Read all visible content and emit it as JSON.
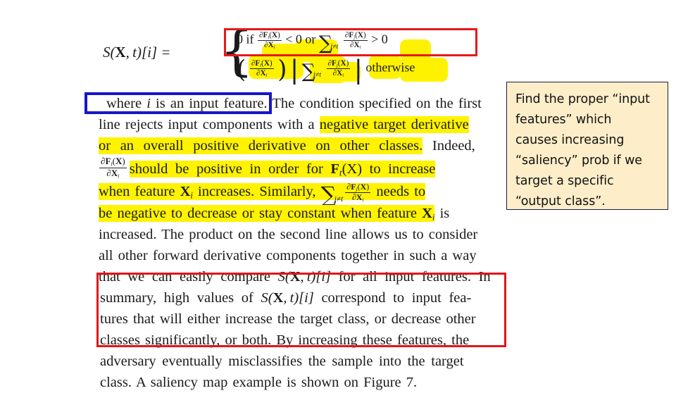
{
  "slide": {
    "background_color": "#ffffff",
    "paper_text_color": "#1b1b1b"
  },
  "equation": {
    "lhs": "S(X, t)[i] =",
    "brace": "{",
    "case_1": {
      "value": "0",
      "condition_prefix": "if",
      "term_1_num": "∂F",
      "term_1_num_sub": "t",
      "term_1_num_arg": "(X)",
      "term_1_den": "∂X",
      "term_1_den_sub": "i",
      "comparator_1": "< 0",
      "connector": "or",
      "sum_symbol": "∑",
      "sum_subscript": "j≠t",
      "term_2_num": "∂F",
      "term_2_num_sub": "j",
      "term_2_num_arg": "(X)",
      "term_2_den": "∂X",
      "term_2_den_sub": "i",
      "comparator_2": "> 0"
    },
    "case_2": {
      "open_paren": "(",
      "term_1_num": "∂F",
      "term_1_num_sub": "t",
      "term_1_num_arg": "(X)",
      "term_1_den": "∂X",
      "term_1_den_sub": "i",
      "close_paren": ")",
      "abs_bar": "|",
      "sum_symbol": "∑",
      "sum_subscript": "j≠t",
      "term_2_num": "∂F",
      "term_2_num_sub": "j",
      "term_2_num_arg": "(X)",
      "term_2_den": "∂X",
      "term_2_den_sub": "i",
      "otherwise": "otherwise"
    }
  },
  "paragraph_lines": [
    {
      "id": "l1",
      "plain_before": "where ",
      "italic": "i",
      "plain_after": " is an input feature. The condition specified on the first",
      "highlight": "none"
    },
    {
      "id": "l2",
      "text_plain": "line rejects input components with a ",
      "text_highlight": "negative target derivative",
      "highlight": "tail"
    },
    {
      "id": "l3",
      "text_highlight": "or an overall positive derivative on other classes.",
      "text_plain": " Indeed,",
      "highlight": "head"
    },
    {
      "id": "l4",
      "text_highlight": "should be positive in order for",
      "text_math": "F_t(X)",
      "text_highlight_2": "to increase",
      "highlight": "full-with-math"
    },
    {
      "id": "l5",
      "text_highlight": "when feature X_i increases. Similarly, ∑_{j≠t} ∂F_j(X)/∂X_i needs to",
      "highlight": "full"
    },
    {
      "id": "l6",
      "text_highlight": "be negative to decrease or stay constant when feature X_i",
      "text_plain": " is",
      "highlight": "most"
    },
    {
      "id": "l7",
      "text": "increased. The product on the second line allows us to consider",
      "highlight": "none"
    },
    {
      "id": "l8",
      "text": "all other forward derivative components together in such a way",
      "highlight": "none"
    },
    {
      "id": "l9",
      "text": "that we can easily compare S(X, t)[i] for all input features. In",
      "highlight": "none"
    },
    {
      "id": "l10",
      "text": "summary, high values of S(X, t)[i] correspond to input fea-",
      "highlight": "none"
    },
    {
      "id": "l11",
      "text": "tures that will either increase the target class, or decrease other",
      "highlight": "none"
    },
    {
      "id": "l12",
      "text": "classes significantly, or both. By increasing these features, the",
      "highlight": "none"
    },
    {
      "id": "l13",
      "text": "adversary eventually misclassifies the sample into the target",
      "highlight": "none"
    },
    {
      "id": "l14",
      "text": "class. A saliency map example is shown on Figure 7.",
      "highlight": "none"
    }
  ],
  "line_text": {
    "l1_a": "where ",
    "l1_i": "i",
    "l1_b": " is an input feature. The condition specified on the first",
    "l2_a": "line rejects input components with a ",
    "l2_hl": "negative target derivative",
    "l3_hl": "or an overall positive derivative on other classes.",
    "l3_b": " Indeed,",
    "l4_hl_a": "should be positive in order for",
    "l4_math": "F",
    "l4_math_sub": "t",
    "l4_math_arg": "(X)",
    "l4_hl_b": "to increase",
    "l5_a": "when feature ",
    "l5_x": "X",
    "l5_xsub": "i",
    "l5_b": " increases. Similarly, ",
    "l5_c": " needs to",
    "l6_a": "be negative to decrease or stay constant when feature ",
    "l6_x": "X",
    "l6_xsub": "i",
    "l6_b": " is",
    "l7": "increased. The product on the second line allows us to consider",
    "l8": "all other forward derivative components together in such a way",
    "l9_a": "that we can easily compare ",
    "l9_math": "S(X, t)[i]",
    "l9_b": " for all input features. In",
    "l10_a": "summary, high values of ",
    "l10_math": "S(X, t)[i]",
    "l10_b": " correspond to input fea-",
    "l11": "tures that will either increase the target class, or decrease other",
    "l12": "classes significantly, or both. By increasing these features, the",
    "l13": "adversary eventually misclassifies the sample into the target",
    "l14": "class. A saliency map example is shown on Figure 7."
  },
  "annotations": {
    "red_box_top": {
      "color": "#e8181a",
      "label": "red-highlight-box-first-case"
    },
    "blue_box": {
      "color": "#1616c8",
      "label": "blue-highlight-box-input-feature"
    },
    "red_box_bottom": {
      "color": "#e0161a",
      "label": "red-highlight-box-summary"
    },
    "marker_color": "#fff200"
  },
  "callout": {
    "background_color": "#fdeec9",
    "border_color": "#1f1b3a",
    "lines": [
      "Find the proper “input",
      "features” which",
      "causes increasing",
      "“saliency” prob if we",
      "target a specific",
      "“output class”."
    ],
    "full_text": "Find the proper “input features” which causes increasing “saliency” prob if we target a specific “output class”."
  }
}
